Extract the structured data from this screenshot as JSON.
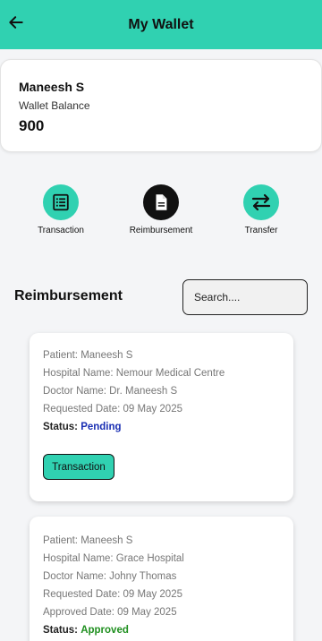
{
  "header": {
    "title": "My Wallet"
  },
  "wallet": {
    "name": "Maneesh S",
    "balance_label": "Wallet Balance",
    "balance": "900"
  },
  "actions": [
    {
      "label": "Transaction",
      "icon": "list-icon",
      "color": "#30d1b1"
    },
    {
      "label": "Reimbursement",
      "icon": "document-icon",
      "color": "#111111"
    },
    {
      "label": "Transfer",
      "icon": "swap-arrows-icon",
      "color": "#30d1b1"
    }
  ],
  "section": {
    "title": "Reimbursement",
    "search_placeholder": "Search...."
  },
  "requests": [
    {
      "patient": "Patient: Maneesh S",
      "hospital": "Hospital Name: Nemour Medical Centre",
      "doctor": "Doctor Name: Dr. Maneesh S",
      "requested": "Requested Date: 09 May 2025",
      "status_label": "Status:",
      "status": "Pending",
      "button": "Transaction"
    },
    {
      "patient": "Patient: Maneesh S",
      "hospital": "Hospital Name: Grace Hospital",
      "doctor": "Doctor Name: Johny Thomas",
      "requested": "Requested Date: 09 May 2025",
      "approved": "Approved Date: 09 May 2025",
      "status_label": "Status:",
      "status": "Approved"
    }
  ],
  "colors": {
    "accent": "#30d1b1",
    "pending": "#1a2fb3",
    "approved": "#1f8f1f"
  }
}
